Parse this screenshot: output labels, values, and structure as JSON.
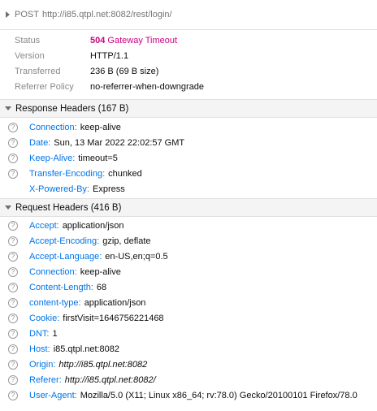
{
  "request": {
    "method": "POST",
    "url": "http://i85.qtpl.net:8082/rest/login/"
  },
  "summary": [
    {
      "label": "Status",
      "code": "504",
      "value": "Gateway Timeout"
    },
    {
      "label": "Version",
      "value": "HTTP/1.1"
    },
    {
      "label": "Transferred",
      "value": "236 B (69 B size)"
    },
    {
      "label": "Referrer Policy",
      "value": "no-referrer-when-downgrade"
    }
  ],
  "response_headers": {
    "title": "Response Headers (167 B)",
    "items": [
      {
        "name": "Connection:",
        "value": "keep-alive",
        "help": true
      },
      {
        "name": "Date:",
        "value": "Sun, 13 Mar 2022 22:02:57 GMT",
        "help": true
      },
      {
        "name": "Keep-Alive:",
        "value": "timeout=5",
        "help": true
      },
      {
        "name": "Transfer-Encoding:",
        "value": "chunked",
        "help": true
      },
      {
        "name": "X-Powered-By:",
        "value": "Express",
        "help": false
      }
    ]
  },
  "request_headers": {
    "title": "Request Headers (416 B)",
    "items": [
      {
        "name": "Accept:",
        "value": "application/json"
      },
      {
        "name": "Accept-Encoding:",
        "value": "gzip, deflate"
      },
      {
        "name": "Accept-Language:",
        "value": "en-US,en;q=0.5"
      },
      {
        "name": "Connection:",
        "value": "keep-alive"
      },
      {
        "name": "Content-Length:",
        "value": "68"
      },
      {
        "name": "content-type:",
        "value": "application/json"
      },
      {
        "name": "Cookie:",
        "value": "firstVisit=1646756221468"
      },
      {
        "name": "DNT:",
        "value": "1"
      },
      {
        "name": "Host:",
        "value": "i85.qtpl.net:8082"
      },
      {
        "name": "Origin:",
        "value": "http://i85.qtpl.net:8082"
      },
      {
        "name": "Referer:",
        "value": "http://i85.qtpl.net:8082/"
      },
      {
        "name": "User-Agent:",
        "value": "Mozilla/5.0 (X11; Linux x86_64; rv:78.0) Gecko/20100101 Firefox/78.0"
      }
    ]
  },
  "icons": {
    "help": "question-circle-icon",
    "collapse": "triangle-down-icon",
    "expand": "triangle-right-icon"
  },
  "colors": {
    "status_error": "#cc0080",
    "header_name": "#0074e8"
  }
}
